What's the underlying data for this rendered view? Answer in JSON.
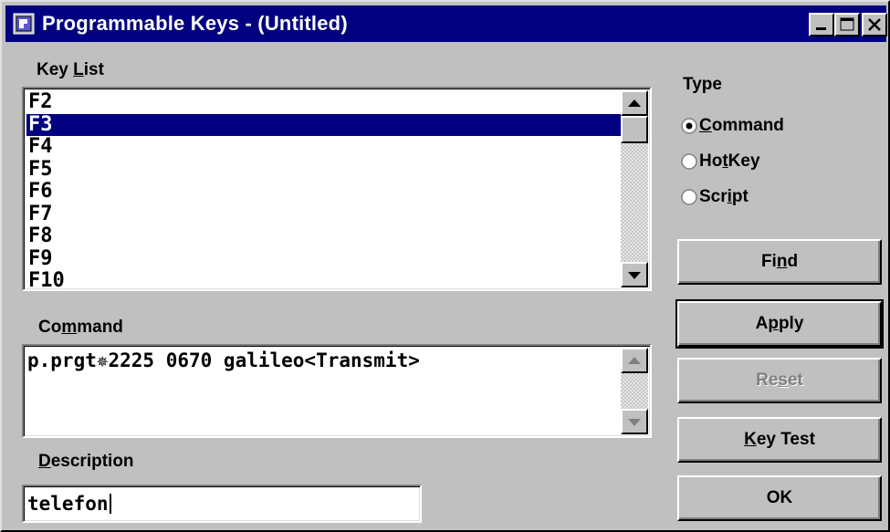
{
  "window": {
    "title": "Programmable Keys - (Untitled)",
    "icon": "app-icon"
  },
  "key_list": {
    "label_pre": "Key ",
    "label_ul": "L",
    "label_post": "ist",
    "items": [
      "F2",
      "F3",
      "F4",
      "F5",
      "F6",
      "F7",
      "F8",
      "F9",
      "F10"
    ],
    "selected": "F3"
  },
  "command": {
    "label_pre": "Co",
    "label_ul": "m",
    "label_post": "mand",
    "value": "p.prgt✵2225 0670 galileo<Transmit>"
  },
  "description": {
    "label_pre": "",
    "label_ul": "D",
    "label_post": "escription",
    "value": "telefon"
  },
  "type": {
    "label": "Type",
    "options": [
      {
        "pre": "",
        "ul": "C",
        "post": "ommand",
        "checked": true
      },
      {
        "pre": "Ho",
        "ul": "t",
        "post": "Key",
        "checked": false
      },
      {
        "pre": "Scr",
        "ul": "i",
        "post": "pt",
        "checked": false
      }
    ]
  },
  "buttons": {
    "find": {
      "pre": "Fi",
      "ul": "n",
      "post": "d"
    },
    "apply": {
      "pre": "A",
      "ul": "p",
      "post": "ply"
    },
    "reset": {
      "pre": "Re",
      "ul": "s",
      "post": "et"
    },
    "key_test": {
      "pre": "",
      "ul": "K",
      "post": "ey Test"
    },
    "ok": {
      "pre": "",
      "ul": "",
      "post": "OK"
    }
  },
  "colors": {
    "titlebar": "#000080",
    "selection": "#000080",
    "face": "#c0c0c0"
  }
}
